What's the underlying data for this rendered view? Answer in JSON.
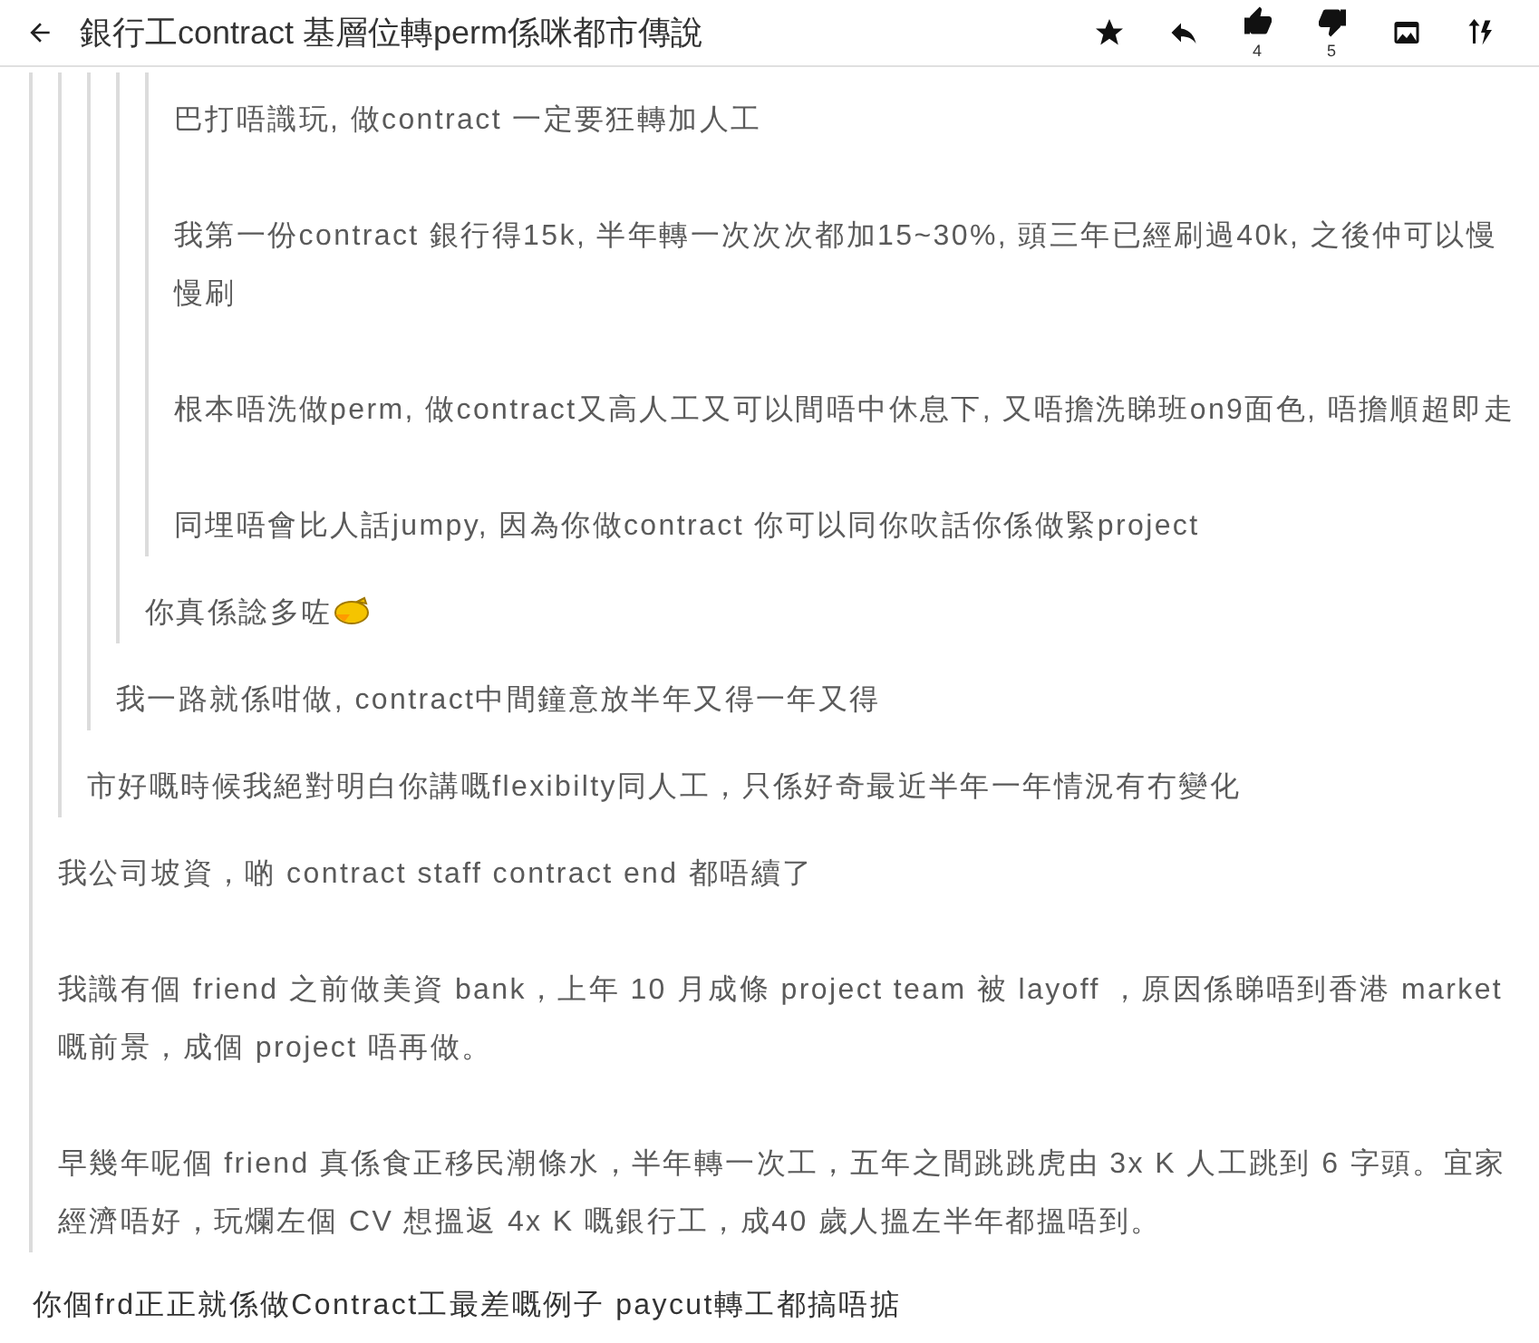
{
  "header": {
    "title": "銀行工contract 基層位轉perm係咪都市傳說",
    "actions": [
      {
        "kind": "star"
      },
      {
        "kind": "reply"
      },
      {
        "kind": "upvote",
        "count": "4"
      },
      {
        "kind": "downvote",
        "count": "5"
      },
      {
        "kind": "image"
      },
      {
        "kind": "sort"
      }
    ]
  },
  "post": {
    "quote": {
      "paragraphs": [
        "我公司坡資，啲 contract staff contract end 都唔續了",
        "我識有個 friend 之前做美資 bank，上年 10 月成條 project team 被 layoff ，原因係睇唔到香港 market 嘅前景，成個 project 唔再做。",
        "早幾年呢個 friend 真係食正移民潮條水，半年轉一次工，五年之間跳跳虎由 3x K 人工跳到 6 字頭。宜家經濟唔好，玩爛左個 CV 想搵返 4x K 嘅銀行工，成40 歲人搵左半年都搵唔到。"
      ],
      "quote": {
        "paragraphs": [
          "市好嘅時候我絕對明白你講嘅flexibilty同人工，只係好奇最近半年一年情況有冇變化"
        ],
        "quote": {
          "paragraphs": [
            "我一路就係咁做, contract中間鐘意放半年又得一年又得"
          ],
          "quote": {
            "paragraphs": [
              "你真係諗多咗"
            ],
            "emoticon": true,
            "quote": {
              "paragraphs": [
                "巴打唔識玩, 做contract 一定要狂轉加人工",
                "我第一份contract 銀行得15k, 半年轉一次次次都加15~30%, 頭三年已經刷過40k, 之後仲可以慢慢刷",
                "根本唔洗做perm, 做contract又高人工又可以間唔中休息下, 又唔擔洗睇班on9面色, 唔擔順超即走",
                "同埋唔會比人話jumpy, 因為你做contract 你可以同你吹話你係做緊project"
              ]
            }
          }
        }
      }
    },
    "paragraphs": [
      "你個frd正正就係做Contract工最差嘅例子 paycut轉工都搞唔掂"
    ]
  }
}
